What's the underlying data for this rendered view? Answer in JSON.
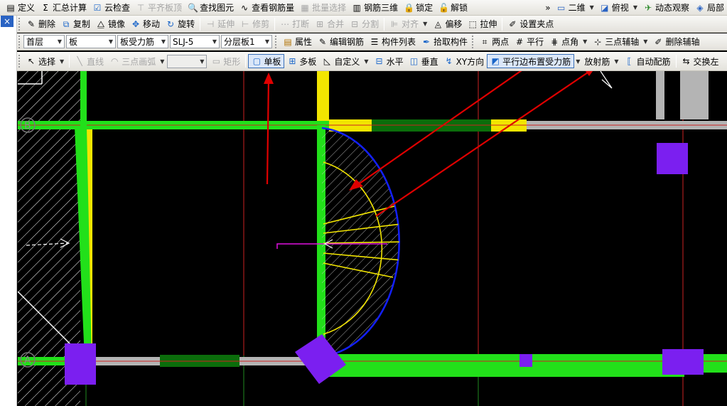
{
  "toolbar1": {
    "items": [
      {
        "label": "定义",
        "icon": "define-icon",
        "disabled": false
      },
      {
        "label": "汇总计算",
        "icon": "sigma-icon",
        "disabled": false
      },
      {
        "label": "云检查",
        "icon": "cloud-check-icon",
        "disabled": false
      },
      {
        "label": "平齐板顶",
        "icon": "align-top-icon",
        "disabled": true
      },
      {
        "label": "查找图元",
        "icon": "find-icon",
        "disabled": false
      },
      {
        "label": "查看钢筋量",
        "icon": "rebar-qty-icon",
        "disabled": false
      },
      {
        "label": "批量选择",
        "icon": "batch-select-icon",
        "disabled": true
      },
      {
        "label": "钢筋三维",
        "icon": "rebar-3d-icon",
        "disabled": false
      },
      {
        "label": "锁定",
        "icon": "lock-icon",
        "disabled": false
      },
      {
        "label": "解锁",
        "icon": "unlock-icon",
        "disabled": false
      }
    ],
    "overflow": "»",
    "view_mode": "二维",
    "view_angle": "俯视",
    "dynamic_view": "动态观察",
    "local": "局部"
  },
  "toolbar2": {
    "items": [
      {
        "label": "删除",
        "icon": "delete-icon"
      },
      {
        "label": "复制",
        "icon": "copy-icon"
      },
      {
        "label": "镜像",
        "icon": "mirror-icon"
      },
      {
        "label": "移动",
        "icon": "move-icon"
      },
      {
        "label": "旋转",
        "icon": "rotate-icon"
      },
      {
        "label": "延伸",
        "icon": "extend-icon",
        "disabled": true
      },
      {
        "label": "修剪",
        "icon": "trim-icon",
        "disabled": true
      },
      {
        "label": "打断",
        "icon": "break-icon",
        "disabled": true
      },
      {
        "label": "合并",
        "icon": "merge-icon",
        "disabled": true
      },
      {
        "label": "分割",
        "icon": "split-icon",
        "disabled": true
      },
      {
        "label": "对齐",
        "icon": "align-icon",
        "disabled": true
      },
      {
        "label": "偏移",
        "icon": "offset-icon"
      },
      {
        "label": "拉伸",
        "icon": "stretch-icon"
      },
      {
        "label": "设置夹点",
        "icon": "grip-point-icon"
      }
    ]
  },
  "toolbar3": {
    "floor": "首层",
    "component_type": "板",
    "rebar_type": "板受力筋",
    "rebar_name": "SLJ-5",
    "layer": "分层板1",
    "actions": [
      {
        "label": "属性",
        "icon": "properties-icon"
      },
      {
        "label": "编辑钢筋",
        "icon": "edit-rebar-icon"
      },
      {
        "label": "构件列表",
        "icon": "component-list-icon"
      },
      {
        "label": "拾取构件",
        "icon": "pick-component-icon"
      },
      {
        "label": "两点",
        "icon": "two-point-icon"
      },
      {
        "label": "平行",
        "icon": "parallel-icon"
      },
      {
        "label": "点角",
        "icon": "point-angle-icon"
      },
      {
        "label": "三点辅轴",
        "icon": "three-point-axis-icon"
      },
      {
        "label": "删除辅轴",
        "icon": "delete-axis-icon"
      }
    ]
  },
  "toolbar4": {
    "select": "选择",
    "line": "直线",
    "arc3": "三点画弧",
    "rect": "矩形",
    "single_board": "单板",
    "multi_board": "多板",
    "custom": "自定义",
    "horizontal": "水平",
    "vertical": "垂直",
    "xy_dir": "XY方向",
    "parallel_edge": "平行边布置受力筋",
    "radial": "放射筋",
    "auto_rebar": "自动配筋",
    "swap": "交换左"
  },
  "canvas": {
    "axis_labels": [
      "B",
      "A"
    ],
    "colors": {
      "background": "#000000",
      "beam_green": "#22e01a",
      "dark_green": "#0b6d0b",
      "yellow": "#f2e500",
      "purple": "#7b1ff0",
      "blue_arc": "#1320ff",
      "annotation_red": "#e00000",
      "gray": "#b4b4b4",
      "magenta": "#e010e0"
    }
  },
  "left_panel": {
    "close": "×"
  }
}
